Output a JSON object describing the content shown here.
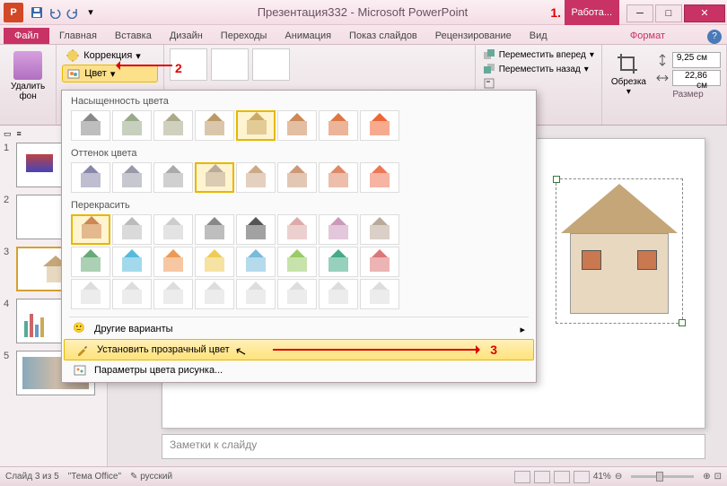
{
  "title": "Презентация332 - Microsoft PowerPoint",
  "worktab": "Работа...",
  "tabs": {
    "file": "Файл",
    "home": "Главная",
    "insert": "Вставка",
    "design": "Дизайн",
    "transitions": "Переходы",
    "animations": "Анимация",
    "slideshow": "Показ слайдов",
    "review": "Рецензирование",
    "view": "Вид",
    "format": "Формат"
  },
  "ribbon": {
    "remove_bg": "Удалить\nфон",
    "corrections": "Коррекция",
    "color": "Цвет",
    "bring_forward": "Переместить вперед",
    "send_backward": "Переместить назад",
    "crop": "Обрезка",
    "size_label": "Размер",
    "height": "9,25 см",
    "width": "22,86 см"
  },
  "color_menu": {
    "saturation": "Насыщенность цвета",
    "tone": "Оттенок цвета",
    "recolor": "Перекрасить",
    "more_variants": "Другие варианты",
    "set_transparent": "Установить прозрачный цвет",
    "params": "Параметры цвета рисунка...",
    "saturation_colors": [
      "#888",
      "#9a8",
      "#aa8",
      "#b96",
      "#ca6",
      "#c85",
      "#d74",
      "#e63"
    ],
    "tone_colors": [
      "#88a",
      "#99a",
      "#aaa",
      "#ba9",
      "#ca8",
      "#c97",
      "#d86",
      "#e75"
    ],
    "recolor_row1": [
      "#c85",
      "#bbb",
      "#ccc",
      "#888",
      "#555",
      "#daa",
      "#c9b",
      "#ba9"
    ],
    "recolor_row2": [
      "#6a7",
      "#5bd",
      "#e95",
      "#ec5",
      "#7bd",
      "#9c6",
      "#4a8",
      "#d77"
    ],
    "recolor_row3": [
      "#ddd",
      "#ddd",
      "#ddd",
      "#ddd",
      "#ddd",
      "#ddd",
      "#ddd",
      "#ddd"
    ]
  },
  "thumbs_tabs": {
    "slides": "",
    "outline": ""
  },
  "slides": [
    {
      "num": "1"
    },
    {
      "num": "2"
    },
    {
      "num": "3"
    },
    {
      "num": "4"
    },
    {
      "num": "5"
    }
  ],
  "notes_placeholder": "Заметки к слайду",
  "status": {
    "slide": "Слайд 3 из 5",
    "theme": "\"Тема Office\"",
    "lang": "русский",
    "zoom": "41%"
  },
  "annotations": {
    "a1": "1",
    "a2": "2",
    "a3": "3"
  }
}
